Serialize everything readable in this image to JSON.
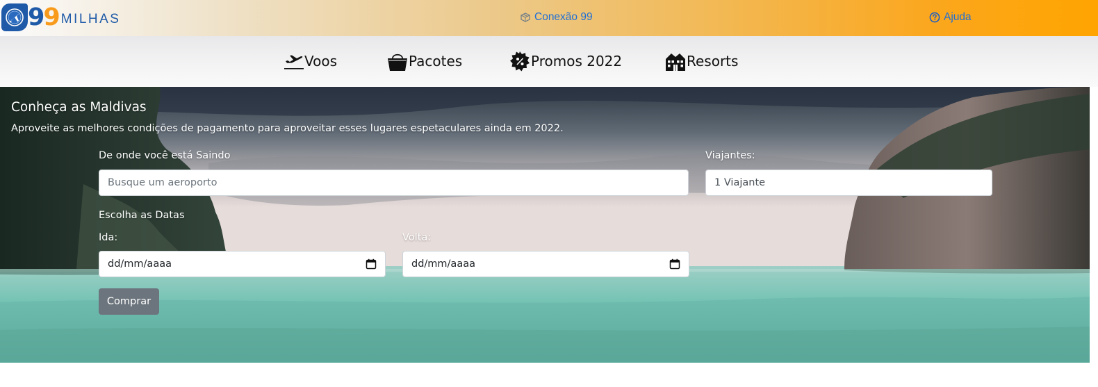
{
  "brand": {
    "logo_digit_1": "9",
    "logo_digit_2": "9",
    "logo_word": "MILHAS",
    "logo_icon": "compass-plane-icon",
    "blue": "#1e5aa8",
    "orange": "#f89b1c"
  },
  "topbar": {
    "conexao_label": "Conexão 99",
    "conexao_icon": "package-icon",
    "ajuda_label": "Ajuda",
    "ajuda_icon": "question-circle-icon",
    "link_color": "#1f6fd6"
  },
  "nav": {
    "items": [
      {
        "label": "Voos",
        "icon": "airplane-takeoff-icon"
      },
      {
        "label": "Pacotes",
        "icon": "basket-icon"
      },
      {
        "label": "Promos 2022",
        "icon": "promo-badge-icon"
      },
      {
        "label": "Resorts",
        "icon": "resort-building-icon"
      }
    ]
  },
  "hero": {
    "title": "Conheça as Maldivas",
    "subtitle": "Aproveite as melhores condições de pagamento para aproveitar esses lugares espetaculares ainda em 2022."
  },
  "form": {
    "origem_label": "De onde você está Saindo",
    "origem_placeholder": "Busque um aeroporto",
    "viajantes_label": "Viajantes:",
    "viajantes_value": "1 Viajante",
    "datas_label": "Escolha as Datas",
    "ida_label": "Ida:",
    "ida_value": "dd/mm/aaaa",
    "volta_label": "Volta:",
    "volta_value": "dd/mm/aaaa",
    "calendar_icon": "calendar-icon",
    "submit_label": "Comprar",
    "submit_color": "#6c757d"
  }
}
